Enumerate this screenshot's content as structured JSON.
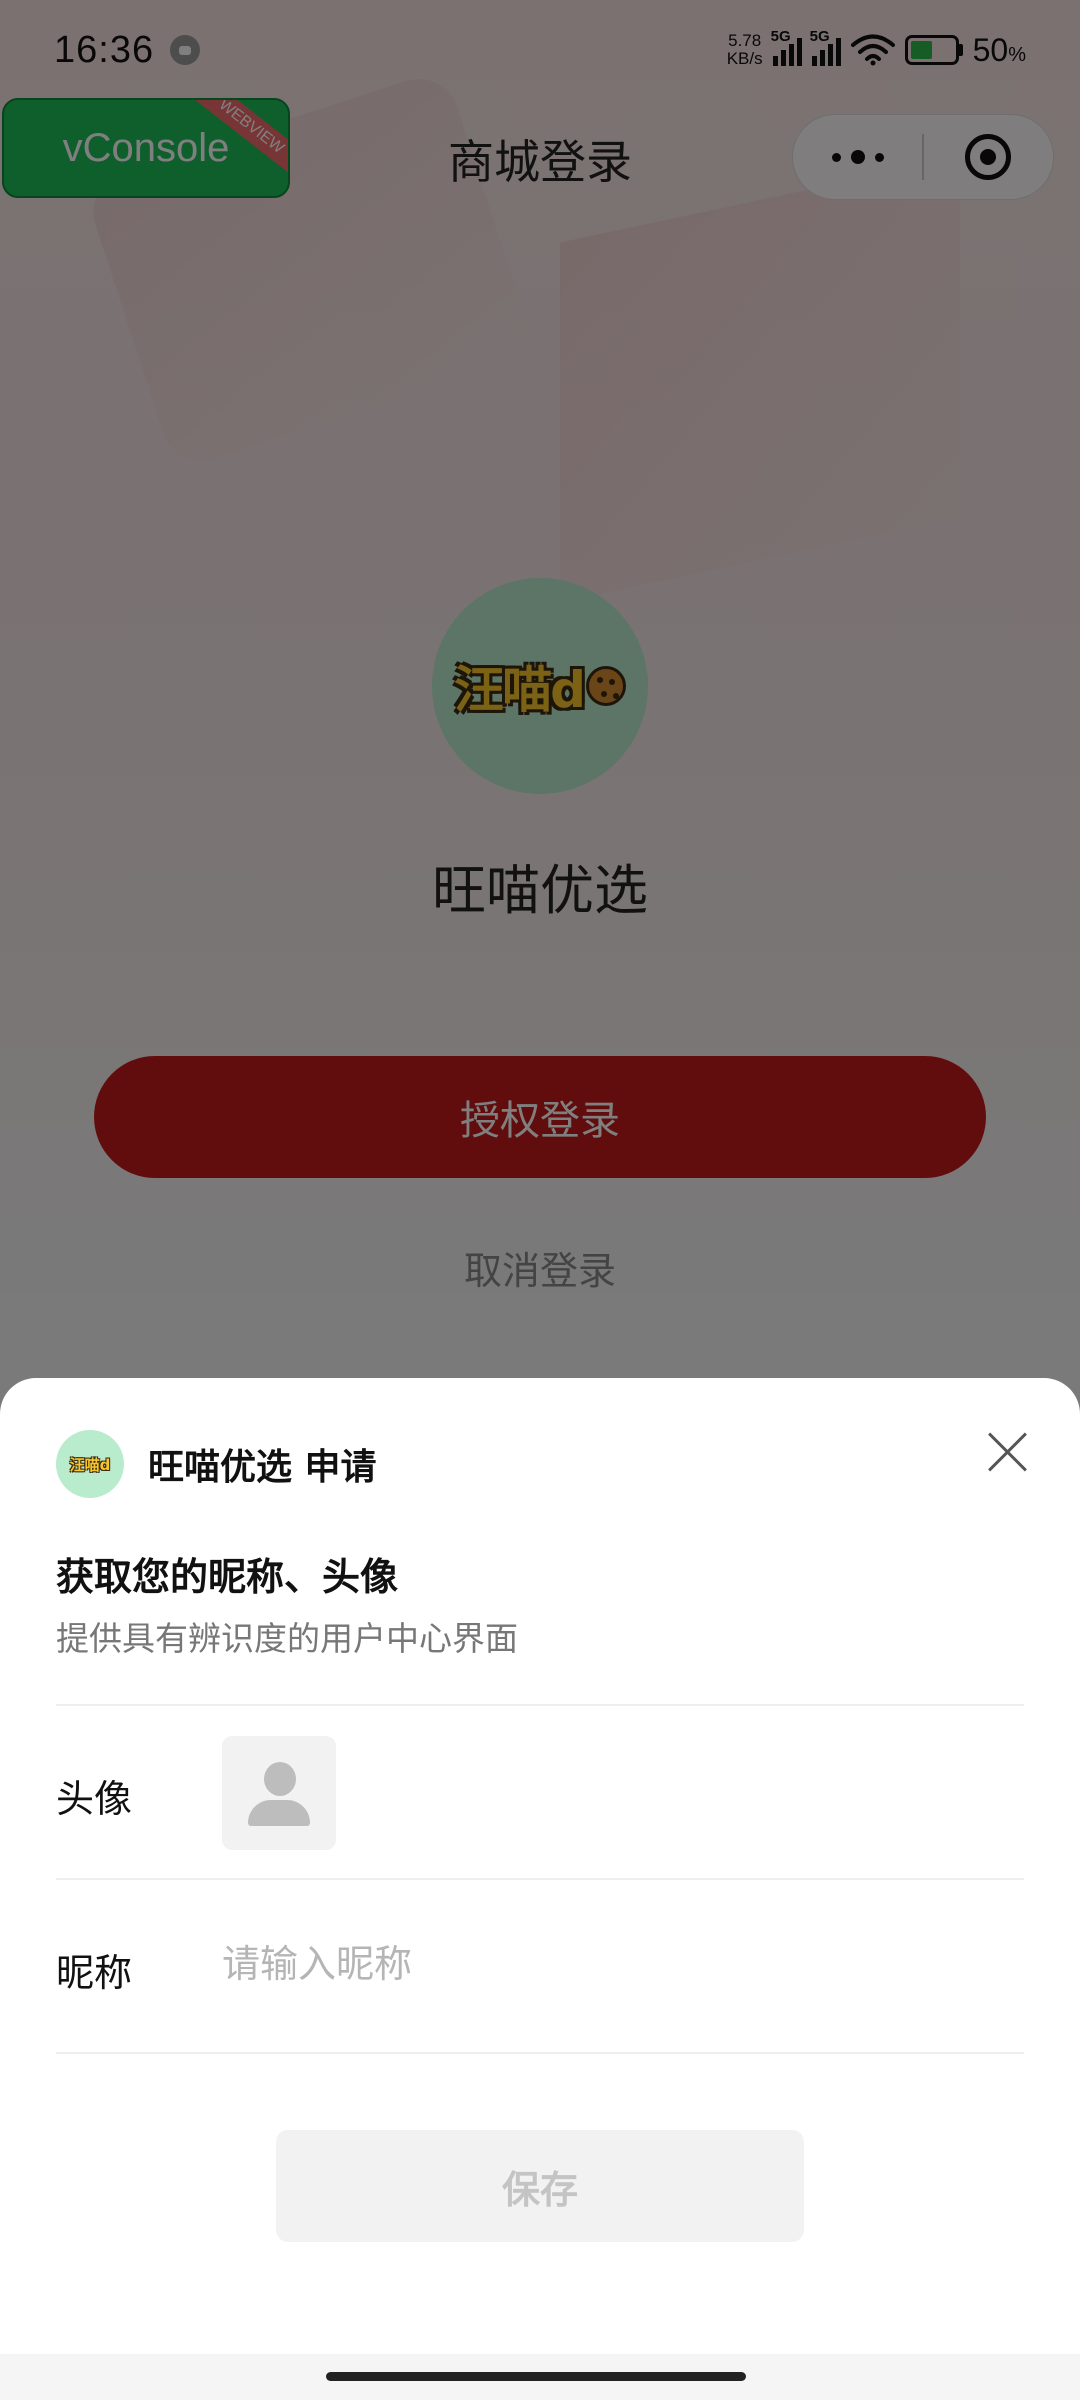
{
  "status_bar": {
    "time": "16:36",
    "net_speed_value": "5.78",
    "net_speed_unit": "KB/s",
    "signal1_tag": "5G",
    "signal2_tag": "5G",
    "battery_percent": "50",
    "battery_unit": "%",
    "battery_level": 0.5
  },
  "vconsole": {
    "label": "vConsole",
    "ribbon": "WEBVIEW"
  },
  "nav": {
    "title": "商城登录"
  },
  "login_page": {
    "logo_text": "汪喵d",
    "shop_name": "旺喵优选",
    "auth_button": "授权登录",
    "cancel_link": "取消登录"
  },
  "sheet": {
    "mini_logo_text": "汪喵d",
    "app_request": "旺喵优选 申请",
    "heading": "获取您的昵称、头像",
    "description": "提供具有辨识度的用户中心界面",
    "avatar_label": "头像",
    "nickname_label": "昵称",
    "nickname_placeholder": "请输入昵称",
    "nickname_value": "",
    "save_button": "保存"
  },
  "colors": {
    "primary_red": "#c41b1b",
    "vconsole_green": "#1fbf5a",
    "logo_mint": "#b9ebcd"
  },
  "icons": [
    "message-icon",
    "wifi-icon",
    "battery-icon",
    "more-dots-icon",
    "capsule-close-icon",
    "close-icon",
    "default-avatar-icon"
  ]
}
